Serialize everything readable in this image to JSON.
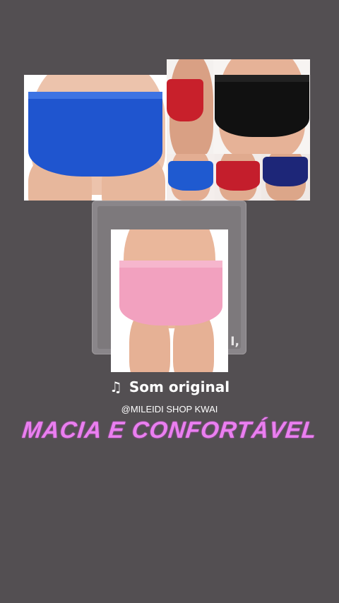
{
  "colors": {
    "background": "#534f52",
    "caption": "#ea7ff0",
    "royal_blue": "#1f55cf",
    "black": "#111111",
    "red": "#c8202b",
    "navy": "#1d2678",
    "pink": "#f2a1bf",
    "skin": "#e9b79d"
  },
  "images": {
    "collage": "product-collage-photo",
    "card": "pink-briefs-photo"
  },
  "music": {
    "icon": "music-note-icon",
    "title": "Som original",
    "handle": "@MILEIDI SHOP KWAI",
    "card_glyph": "I,"
  },
  "caption": "MACIA E CONFORTÁVEL"
}
